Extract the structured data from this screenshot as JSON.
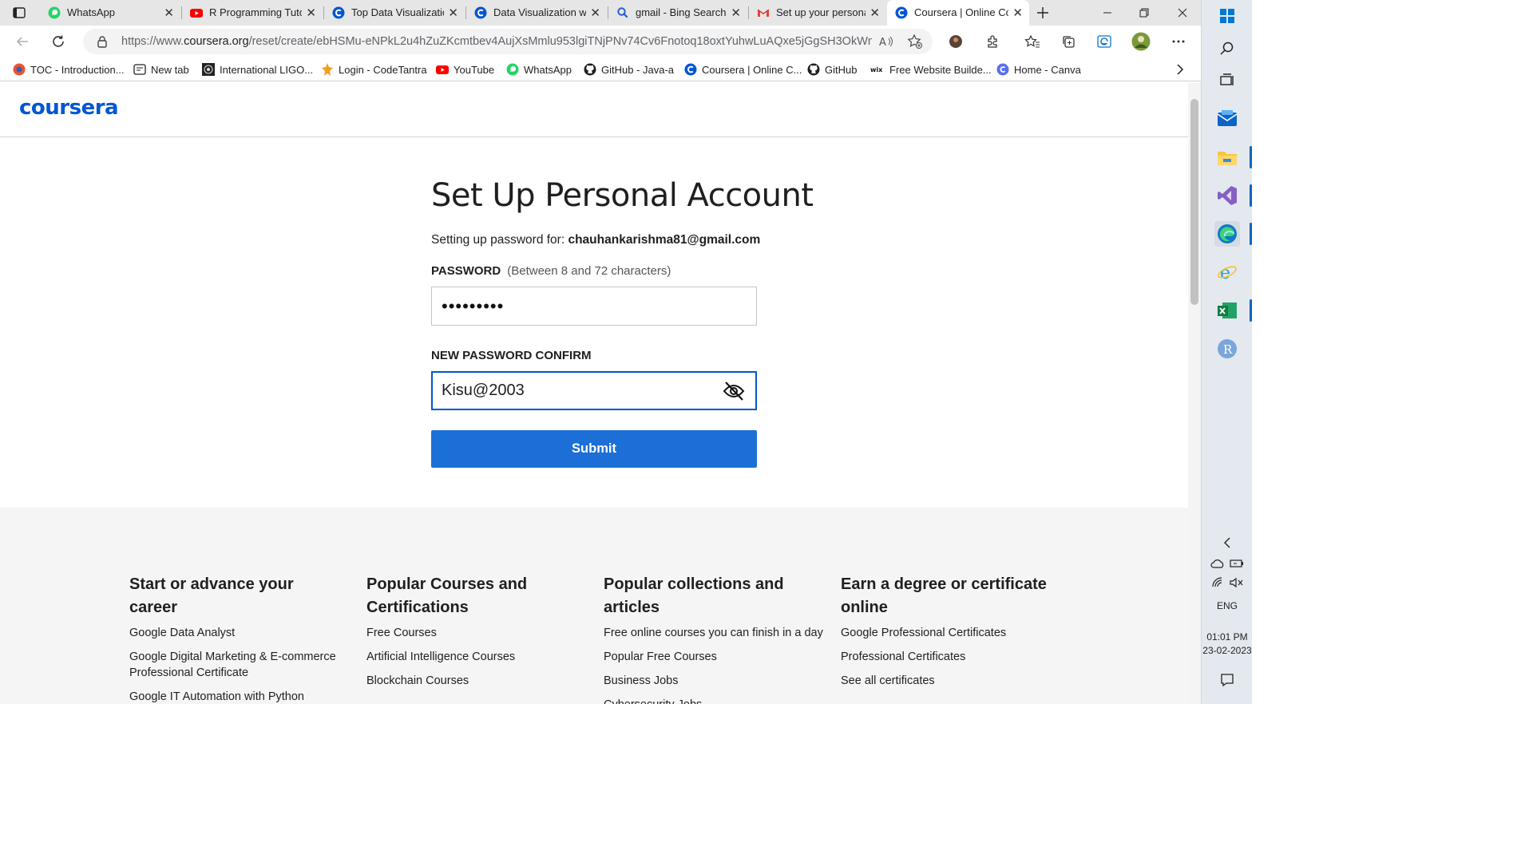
{
  "browser": {
    "tabs": [
      {
        "title": "WhatsApp",
        "icon": "whatsapp-icon"
      },
      {
        "title": "R Programming Tuto",
        "icon": "youtube-icon"
      },
      {
        "title": "Top Data Visualizatio",
        "icon": "coursera-icon"
      },
      {
        "title": "Data Visualization w",
        "icon": "coursera-icon"
      },
      {
        "title": "gmail - Bing Search",
        "icon": "search-icon"
      },
      {
        "title": "Set up your persona",
        "icon": "gmail-icon"
      },
      {
        "title": "Coursera | Online Co",
        "icon": "coursera-icon",
        "active": true
      }
    ],
    "url_prefix": "https://www.",
    "url_domain": "coursera.org",
    "url_rest": "/reset/create/ebHSMu-eNPkL2u4hZuZKcmtbev4AujXsMmlu953lgiTNjPNv74Cv6Fnotoq18oxtYuhwLuAQxe5jGgSH3OkWm...",
    "favorites": [
      {
        "label": "TOC - Introduction...",
        "icon": "toc-icon"
      },
      {
        "label": "New tab",
        "icon": "newtab-icon"
      },
      {
        "label": "International LIGO...",
        "icon": "ligo-icon"
      },
      {
        "label": "Login - CodeTantra",
        "icon": "codetantra-icon"
      },
      {
        "label": "YouTube",
        "icon": "youtube-icon"
      },
      {
        "label": "WhatsApp",
        "icon": "whatsapp-icon"
      },
      {
        "label": "GitHub - Java-a",
        "icon": "github-icon"
      },
      {
        "label": "Coursera | Online C...",
        "icon": "coursera-icon"
      },
      {
        "label": "GitHub",
        "icon": "github-icon"
      },
      {
        "label": "Free Website Builde...",
        "icon": "wix-icon"
      },
      {
        "label": "Home - Canva",
        "icon": "canva-icon"
      }
    ]
  },
  "page": {
    "logo": "coursera",
    "title": "Set Up Personal Account",
    "setting_prefix": "Setting up password for:",
    "email": "chauhankarishma81@gmail.com",
    "password_label": "PASSWORD",
    "password_hint": "(Between 8 and 72 characters)",
    "password_value": "•••••••••",
    "confirm_label": "NEW PASSWORD CONFIRM",
    "confirm_value": "Kisu@2003",
    "submit_label": "Submit"
  },
  "footer": {
    "columns": [
      {
        "heading": "Start or advance your career",
        "links": [
          "Google Data Analyst",
          "Google Digital Marketing & E-commerce Professional Certificate",
          "Google IT Automation with Python Professional Certificate"
        ]
      },
      {
        "heading": "Popular Courses and Certifications",
        "links": [
          "Free Courses",
          "Artificial Intelligence Courses",
          "Blockchain Courses"
        ]
      },
      {
        "heading": "Popular collections and articles",
        "links": [
          "Free online courses you can finish in a day",
          "Popular Free Courses",
          "Business Jobs",
          "Cybersecurity Jobs"
        ]
      },
      {
        "heading": "Earn a degree or certificate online",
        "links": [
          "Google Professional Certificates",
          "Professional Certificates",
          "See all certificates"
        ]
      }
    ]
  },
  "system": {
    "language": "ENG",
    "time": "01:01 PM",
    "date": "23-02-2023"
  },
  "colors": {
    "brand": "#0056d2",
    "submit": "#1b6fd6",
    "footer_bg": "#f5f5f5"
  }
}
